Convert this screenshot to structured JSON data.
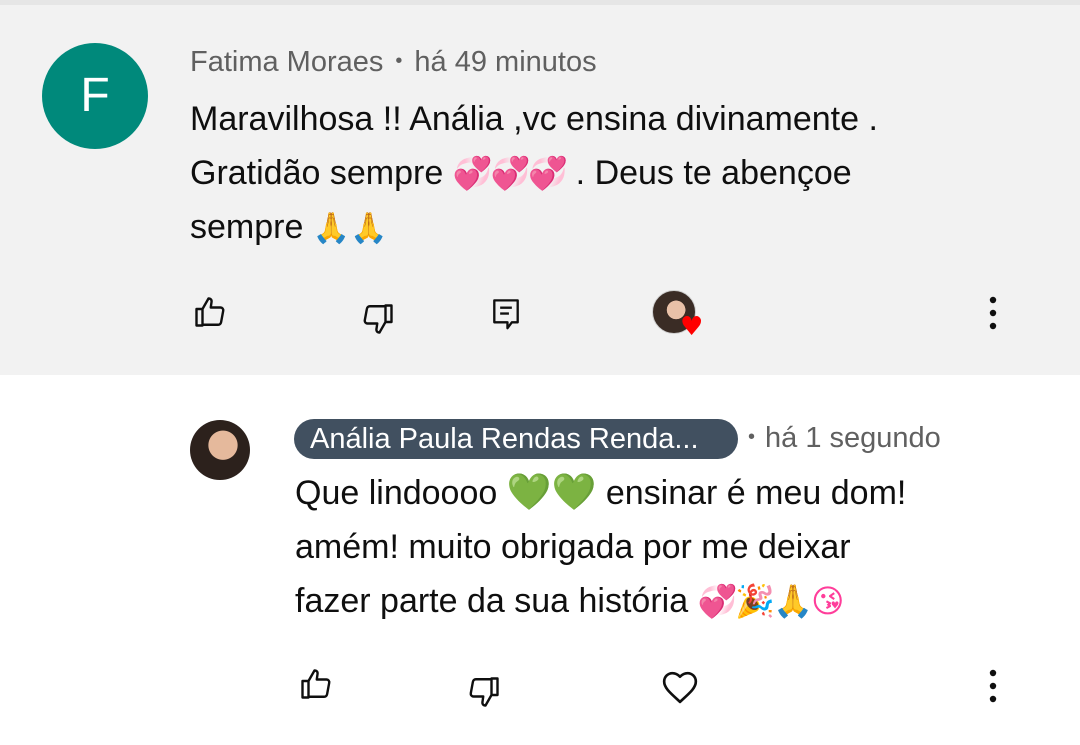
{
  "comment": {
    "avatar_letter": "F",
    "author": "Fatima Moraes",
    "separator": "•",
    "time": "há 49 minutos",
    "text_line1": "Maravilhosa !! Anália ,vc ensina divinamente .",
    "text_line2_a": "Gratidão sempre",
    "emoji_hearts": "💞💞💞",
    "text_line2_b": ". Deus te abençoe",
    "text_line3": "sempre",
    "emoji_pray": "🙏🙏",
    "icons": [
      "thumbs-up-icon",
      "thumbs-down-icon",
      "reply-icon",
      "creator-heart-icon",
      "more-vert-icon"
    ]
  },
  "reply": {
    "author": "Anália Paula Rendas Renda...",
    "separator": "•",
    "time": "há 1 segundo",
    "text_line1_a": "Que lindoooo",
    "emoji_green_hearts": "💚💚",
    "text_line1_b": "ensinar é meu dom!",
    "text_line2": "amém! muito obrigada por me deixar",
    "text_line3": "fazer parte da sua história",
    "emoji_end": "💞🎉🙏😘",
    "icons": [
      "thumbs-up-icon",
      "thumbs-down-icon",
      "heart-outline-icon",
      "more-vert-icon"
    ]
  },
  "colors": {
    "comment_bg": "#f2f2f2",
    "avatar_bg": "#00897b",
    "author_chip_bg": "#415060",
    "meta_text": "#606060",
    "heart_red": "#ff0000"
  }
}
